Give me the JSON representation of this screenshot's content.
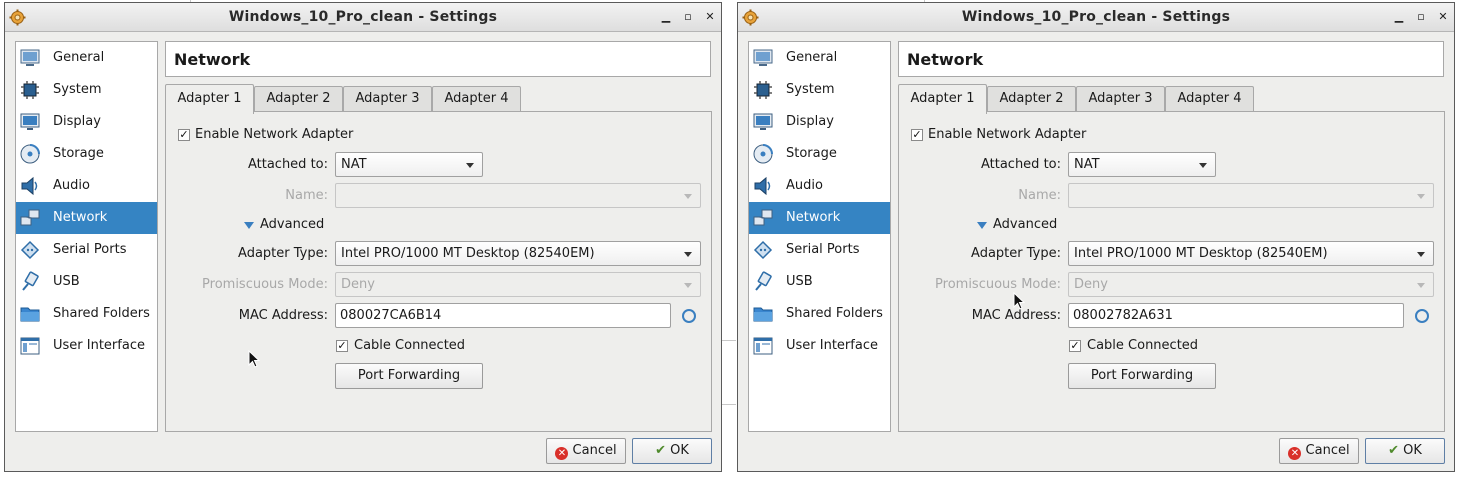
{
  "windows": [
    {
      "title": "Windows_10_Pro_clean - Settings",
      "window_controls": {
        "minimize": "▁",
        "maximize": "▫",
        "close": "✕"
      },
      "sidebar": {
        "items": [
          {
            "label": "General",
            "icon": "general-icon"
          },
          {
            "label": "System",
            "icon": "system-icon"
          },
          {
            "label": "Display",
            "icon": "display-icon"
          },
          {
            "label": "Storage",
            "icon": "storage-icon"
          },
          {
            "label": "Audio",
            "icon": "audio-icon"
          },
          {
            "label": "Network",
            "icon": "network-icon",
            "selected": true
          },
          {
            "label": "Serial Ports",
            "icon": "serial-ports-icon"
          },
          {
            "label": "USB",
            "icon": "usb-icon"
          },
          {
            "label": "Shared Folders",
            "icon": "shared-folders-icon"
          },
          {
            "label": "User Interface",
            "icon": "user-interface-icon"
          }
        ]
      },
      "section_title": "Network",
      "tabs": [
        "Adapter 1",
        "Adapter 2",
        "Adapter 3",
        "Adapter 4"
      ],
      "active_tab": "Adapter 1",
      "form": {
        "enable_label": "Enable Network Adapter",
        "enable_checked": true,
        "attached_label": "Attached to:",
        "attached_value": "NAT",
        "name_label": "Name:",
        "name_value": "",
        "advanced_label": "Advanced",
        "adapter_type_label": "Adapter Type:",
        "adapter_type_value": "Intel PRO/1000 MT Desktop (82540EM)",
        "promiscuous_label": "Promiscuous Mode:",
        "promiscuous_value": "Deny",
        "mac_label": "MAC Address:",
        "mac_value": "080027CA6B14",
        "cable_label": "Cable Connected",
        "cable_checked": true,
        "port_forwarding_label": "Port Forwarding"
      },
      "buttons": {
        "cancel": "Cancel",
        "ok": "OK"
      }
    },
    {
      "title": "Windows_10_Pro_clean - Settings",
      "window_controls": {
        "minimize": "▁",
        "maximize": "▫",
        "close": "✕"
      },
      "sidebar": {
        "items": [
          {
            "label": "General",
            "icon": "general-icon"
          },
          {
            "label": "System",
            "icon": "system-icon"
          },
          {
            "label": "Display",
            "icon": "display-icon"
          },
          {
            "label": "Storage",
            "icon": "storage-icon"
          },
          {
            "label": "Audio",
            "icon": "audio-icon"
          },
          {
            "label": "Network",
            "icon": "network-icon",
            "selected": true
          },
          {
            "label": "Serial Ports",
            "icon": "serial-ports-icon"
          },
          {
            "label": "USB",
            "icon": "usb-icon"
          },
          {
            "label": "Shared Folders",
            "icon": "shared-folders-icon"
          },
          {
            "label": "User Interface",
            "icon": "user-interface-icon"
          }
        ]
      },
      "section_title": "Network",
      "tabs": [
        "Adapter 1",
        "Adapter 2",
        "Adapter 3",
        "Adapter 4"
      ],
      "active_tab": "Adapter 1",
      "form": {
        "enable_label": "Enable Network Adapter",
        "enable_checked": true,
        "attached_label": "Attached to:",
        "attached_value": "NAT",
        "name_label": "Name:",
        "name_value": "",
        "advanced_label": "Advanced",
        "adapter_type_label": "Adapter Type:",
        "adapter_type_value": "Intel PRO/1000 MT Desktop (82540EM)",
        "promiscuous_label": "Promiscuous Mode:",
        "promiscuous_value": "Deny",
        "mac_label": "MAC Address:",
        "mac_value": "08002782A631",
        "cable_label": "Cable Connected",
        "cable_checked": true,
        "port_forwarding_label": "Port Forwarding"
      },
      "buttons": {
        "cancel": "Cancel",
        "ok": "OK"
      }
    }
  ],
  "colors": {
    "selection": "#3584c3",
    "accent_icon": "#3a7fc0",
    "cancel_red": "#d9302a",
    "ok_green": "#4f8a2c"
  }
}
